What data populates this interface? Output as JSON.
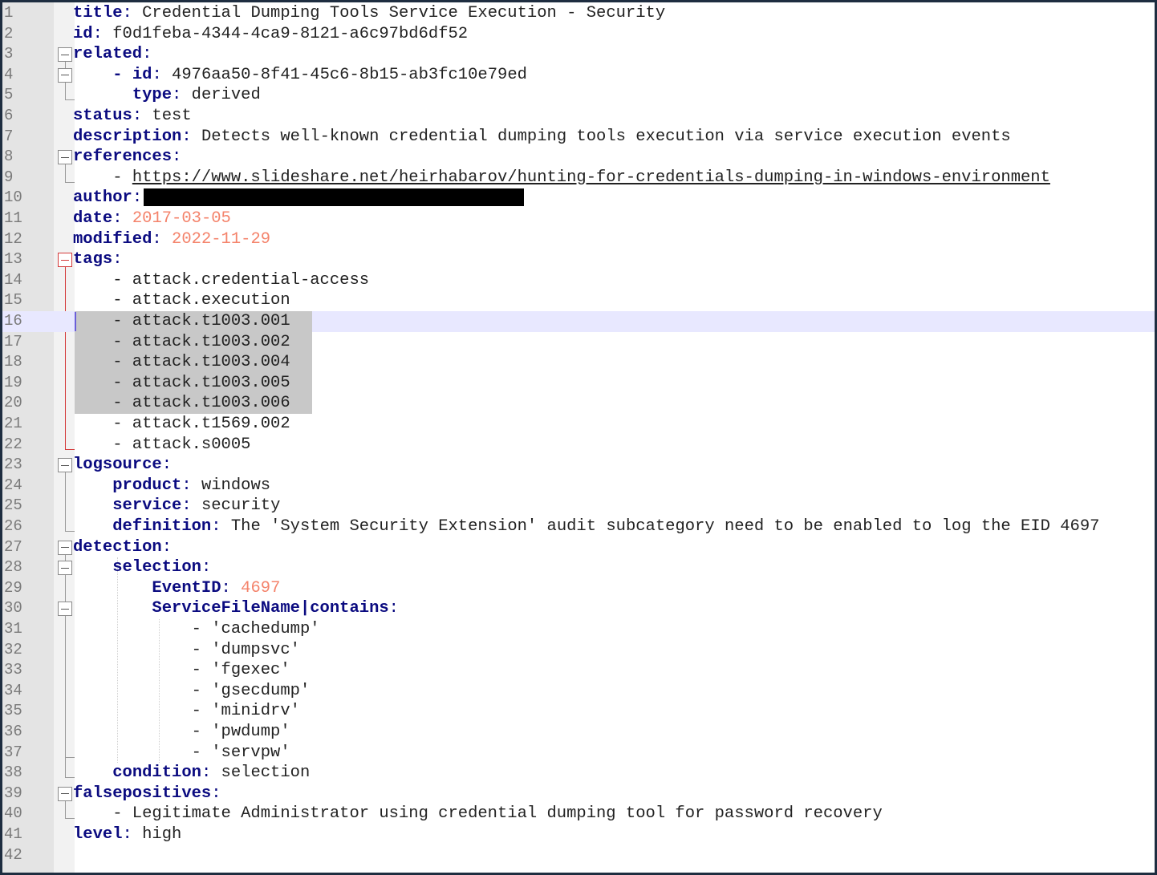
{
  "editor": {
    "lines": [
      {
        "n": "1",
        "parts": [
          [
            "key",
            "title"
          ],
          [
            "punct",
            ":"
          ],
          [
            "txt",
            " Credential Dumping Tools Service Execution - Security"
          ]
        ]
      },
      {
        "n": "2",
        "parts": [
          [
            "key",
            "id"
          ],
          [
            "punct",
            ":"
          ],
          [
            "txt",
            " f0d1feba-4344-4ca9-8121-a6c97bd6df52"
          ]
        ]
      },
      {
        "n": "3",
        "parts": [
          [
            "key",
            "related"
          ],
          [
            "punct",
            ":"
          ]
        ]
      },
      {
        "n": "4",
        "parts": [
          [
            "txt",
            "    "
          ],
          [
            "key",
            "- id"
          ],
          [
            "punct",
            ":"
          ],
          [
            "txt",
            " 4976aa50-8f41-45c6-8b15-ab3fc10e79ed"
          ]
        ]
      },
      {
        "n": "5",
        "parts": [
          [
            "txt",
            "      "
          ],
          [
            "key",
            "type"
          ],
          [
            "punct",
            ":"
          ],
          [
            "txt",
            " derived"
          ]
        ]
      },
      {
        "n": "6",
        "parts": [
          [
            "key",
            "status"
          ],
          [
            "punct",
            ":"
          ],
          [
            "txt",
            " test"
          ]
        ]
      },
      {
        "n": "7",
        "parts": [
          [
            "key",
            "description"
          ],
          [
            "punct",
            ":"
          ],
          [
            "txt",
            " Detects well-known credential dumping tools execution via service execution events"
          ]
        ]
      },
      {
        "n": "8",
        "parts": [
          [
            "key",
            "references"
          ],
          [
            "punct",
            ":"
          ]
        ]
      },
      {
        "n": "9",
        "parts": [
          [
            "txt",
            "    - "
          ],
          [
            "link",
            "https://www.slideshare.net/heirhabarov/hunting-for-credentials-dumping-in-windows-environment"
          ]
        ]
      },
      {
        "n": "10",
        "parts": [
          [
            "key",
            "author"
          ],
          [
            "punct",
            ":"
          ],
          [
            "redact",
            ""
          ]
        ]
      },
      {
        "n": "11",
        "parts": [
          [
            "key",
            "date"
          ],
          [
            "punct",
            ":"
          ],
          [
            "txt",
            " "
          ],
          [
            "num",
            "2017-03-05"
          ]
        ]
      },
      {
        "n": "12",
        "parts": [
          [
            "key",
            "modified"
          ],
          [
            "punct",
            ":"
          ],
          [
            "txt",
            " "
          ],
          [
            "num",
            "2022-11-29"
          ]
        ]
      },
      {
        "n": "13",
        "parts": [
          [
            "key",
            "tags"
          ],
          [
            "punct",
            ":"
          ]
        ]
      },
      {
        "n": "14",
        "parts": [
          [
            "txt",
            "    - attack.credential-access"
          ]
        ]
      },
      {
        "n": "15",
        "parts": [
          [
            "txt",
            "    - attack.execution"
          ]
        ]
      },
      {
        "n": "16",
        "parts": [
          [
            "txt",
            "    - attack.t1003.001"
          ]
        ]
      },
      {
        "n": "17",
        "parts": [
          [
            "txt",
            "    - attack.t1003.002"
          ]
        ]
      },
      {
        "n": "18",
        "parts": [
          [
            "txt",
            "    - attack.t1003.004"
          ]
        ]
      },
      {
        "n": "19",
        "parts": [
          [
            "txt",
            "    - attack.t1003.005"
          ]
        ]
      },
      {
        "n": "20",
        "parts": [
          [
            "txt",
            "    - attack.t1003.006"
          ]
        ]
      },
      {
        "n": "21",
        "parts": [
          [
            "txt",
            "    - attack.t1569.002"
          ]
        ]
      },
      {
        "n": "22",
        "parts": [
          [
            "txt",
            "    - attack.s0005"
          ]
        ]
      },
      {
        "n": "23",
        "parts": [
          [
            "key",
            "logsource"
          ],
          [
            "punct",
            ":"
          ]
        ]
      },
      {
        "n": "24",
        "parts": [
          [
            "txt",
            "    "
          ],
          [
            "key",
            "product"
          ],
          [
            "punct",
            ":"
          ],
          [
            "txt",
            " windows"
          ]
        ]
      },
      {
        "n": "25",
        "parts": [
          [
            "txt",
            "    "
          ],
          [
            "key",
            "service"
          ],
          [
            "punct",
            ":"
          ],
          [
            "txt",
            " security"
          ]
        ]
      },
      {
        "n": "26",
        "parts": [
          [
            "txt",
            "    "
          ],
          [
            "key",
            "definition"
          ],
          [
            "punct",
            ":"
          ],
          [
            "txt",
            " The 'System Security Extension' audit subcategory need to be enabled to log the EID 4697"
          ]
        ]
      },
      {
        "n": "27",
        "parts": [
          [
            "key",
            "detection"
          ],
          [
            "punct",
            ":"
          ]
        ]
      },
      {
        "n": "28",
        "parts": [
          [
            "txt",
            "    "
          ],
          [
            "key",
            "selection"
          ],
          [
            "punct",
            ":"
          ]
        ]
      },
      {
        "n": "29",
        "parts": [
          [
            "txt",
            "        "
          ],
          [
            "key",
            "EventID"
          ],
          [
            "punct",
            ":"
          ],
          [
            "txt",
            " "
          ],
          [
            "num",
            "4697"
          ]
        ]
      },
      {
        "n": "30",
        "parts": [
          [
            "txt",
            "        "
          ],
          [
            "key",
            "ServiceFileName|contains"
          ],
          [
            "punct",
            ":"
          ]
        ]
      },
      {
        "n": "31",
        "parts": [
          [
            "txt",
            "            - 'cachedump'"
          ]
        ]
      },
      {
        "n": "32",
        "parts": [
          [
            "txt",
            "            - 'dumpsvc'"
          ]
        ]
      },
      {
        "n": "33",
        "parts": [
          [
            "txt",
            "            - 'fgexec'"
          ]
        ]
      },
      {
        "n": "34",
        "parts": [
          [
            "txt",
            "            - 'gsecdump'"
          ]
        ]
      },
      {
        "n": "35",
        "parts": [
          [
            "txt",
            "            - 'minidrv'"
          ]
        ]
      },
      {
        "n": "36",
        "parts": [
          [
            "txt",
            "            - 'pwdump'"
          ]
        ]
      },
      {
        "n": "37",
        "parts": [
          [
            "txt",
            "            - 'servpw'"
          ]
        ]
      },
      {
        "n": "38",
        "parts": [
          [
            "txt",
            "    "
          ],
          [
            "key",
            "condition"
          ],
          [
            "punct",
            ":"
          ],
          [
            "txt",
            " selection"
          ]
        ]
      },
      {
        "n": "39",
        "parts": [
          [
            "key",
            "falsepositives"
          ],
          [
            "punct",
            ":"
          ]
        ]
      },
      {
        "n": "40",
        "parts": [
          [
            "txt",
            "    - Legitimate Administrator using credential dumping tool for password recovery"
          ]
        ]
      },
      {
        "n": "41",
        "parts": [
          [
            "key",
            "level"
          ],
          [
            "punct",
            ":"
          ],
          [
            "txt",
            " high"
          ]
        ]
      },
      {
        "n": "42",
        "parts": []
      }
    ]
  }
}
